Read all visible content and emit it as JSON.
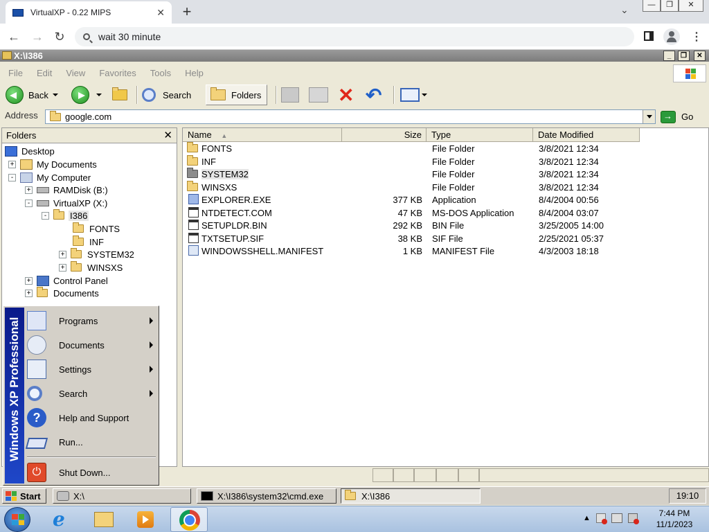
{
  "browser": {
    "tab_title": "VirtualXP - 0.22 MIPS",
    "address_value": "wait 30 minute"
  },
  "window": {
    "title": "X:\\I386",
    "menu": [
      "File",
      "Edit",
      "View",
      "Favorites",
      "Tools",
      "Help"
    ],
    "toolbar": {
      "back_label": "Back",
      "search_label": "Search",
      "folders_label": "Folders"
    },
    "address": {
      "label": "Address",
      "value": "google.com",
      "go_label": "Go"
    }
  },
  "folders_pane": {
    "title": "Folders",
    "tree": [
      {
        "label": "Desktop",
        "icon": "desktop-icon",
        "expander": ""
      },
      {
        "label": "My Documents",
        "icon": "my-documents-icon",
        "expander": "+"
      },
      {
        "label": "My Computer",
        "icon": "my-computer-icon",
        "expander": "-"
      },
      {
        "label": "RAMDisk (B:)",
        "icon": "drive-icon",
        "expander": "+"
      },
      {
        "label": "VirtualXP (X:)",
        "icon": "drive-icon",
        "expander": "-"
      },
      {
        "label": "I386",
        "icon": "folder-icon",
        "expander": "-"
      },
      {
        "label": "FONTS",
        "icon": "folder-icon",
        "expander": ""
      },
      {
        "label": "INF",
        "icon": "folder-icon",
        "expander": ""
      },
      {
        "label": "SYSTEM32",
        "icon": "folder-icon",
        "expander": "+"
      },
      {
        "label": "WINSXS",
        "icon": "folder-icon",
        "expander": "+"
      },
      {
        "label": "Control Panel",
        "icon": "control-panel-icon",
        "expander": "+"
      },
      {
        "label": "Documents",
        "icon": "folder-icon",
        "expander": "+"
      }
    ]
  },
  "files": {
    "columns": {
      "name": "Name",
      "size": "Size",
      "type": "Type",
      "date": "Date Modified"
    },
    "rows": [
      {
        "name": "FONTS",
        "size": "",
        "type": "File Folder",
        "date": "3/8/2021 12:34",
        "icon": "folder-icon"
      },
      {
        "name": "INF",
        "size": "",
        "type": "File Folder",
        "date": "3/8/2021 12:34",
        "icon": "folder-icon"
      },
      {
        "name": "SYSTEM32",
        "size": "",
        "type": "File Folder",
        "date": "3/8/2021 12:34",
        "icon": "folder-icon"
      },
      {
        "name": "WINSXS",
        "size": "",
        "type": "File Folder",
        "date": "3/8/2021 12:34",
        "icon": "folder-icon"
      },
      {
        "name": "EXPLORER.EXE",
        "size": "377 KB",
        "type": "Application",
        "date": "8/4/2004 00:56",
        "icon": "application-icon"
      },
      {
        "name": "NTDETECT.COM",
        "size": "47 KB",
        "type": "MS-DOS Application",
        "date": "8/4/2004 03:07",
        "icon": "dos-application-icon"
      },
      {
        "name": "SETUPLDR.BIN",
        "size": "292 KB",
        "type": "BIN File",
        "date": "3/25/2005 14:00",
        "icon": "file-icon"
      },
      {
        "name": "TXTSETUP.SIF",
        "size": "38 KB",
        "type": "SIF File",
        "date": "2/25/2021 05:37",
        "icon": "file-icon"
      },
      {
        "name": "WINDOWSSHELL.MANIFEST",
        "size": "1 KB",
        "type": "MANIFEST File",
        "date": "4/3/2003 18:18",
        "icon": "manifest-icon"
      }
    ]
  },
  "start_menu": {
    "banner": "Windows XP Professional",
    "items": [
      {
        "label": "Programs",
        "icon": "programs-icon",
        "submenu": true
      },
      {
        "label": "Documents",
        "icon": "documents-icon",
        "submenu": true
      },
      {
        "label": "Settings",
        "icon": "settings-icon",
        "submenu": true
      },
      {
        "label": "Search",
        "icon": "search-icon",
        "submenu": true
      },
      {
        "label": "Help and Support",
        "icon": "help-icon",
        "submenu": false
      },
      {
        "label": "Run...",
        "icon": "run-icon",
        "submenu": false
      },
      {
        "label": "Shut Down...",
        "icon": "shutdown-icon",
        "submenu": false
      }
    ]
  },
  "xp_taskbar": {
    "start_label": "Start",
    "buttons": [
      "X:\\",
      "X:\\I386\\system32\\cmd.exe",
      "X:\\I386"
    ],
    "clock": "19:10"
  },
  "host_taskbar": {
    "time": "7:44 PM",
    "date": "11/1/2023"
  },
  "colors": {
    "xp_face": "#ece9d8",
    "start_banner": "#1f47c8",
    "host_taskbar": "#a9c2e0"
  }
}
